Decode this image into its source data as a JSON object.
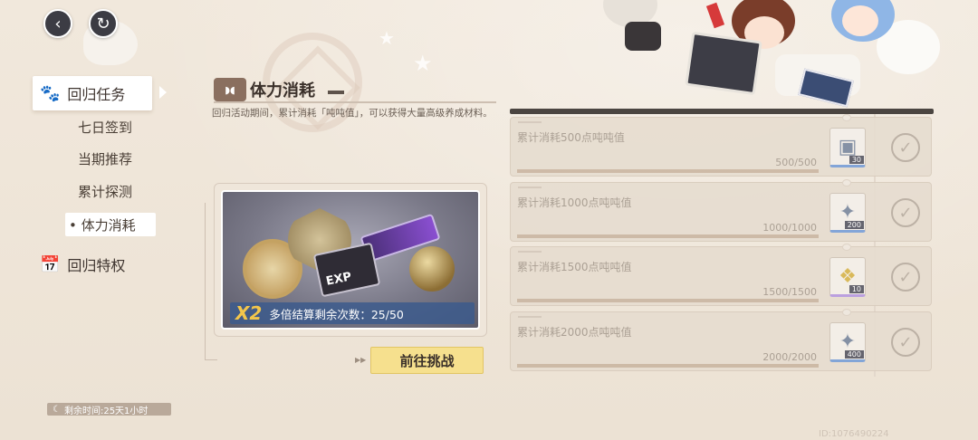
{
  "nav": {
    "back_icon": "back-arrow-icon",
    "refresh_icon": "refresh-icon"
  },
  "sidebar": {
    "main_items": [
      {
        "label": "回归任务",
        "icon": "paw-icon",
        "active": true
      },
      {
        "label": "回归特权",
        "icon": "calendar-icon",
        "active": false
      }
    ],
    "sub_items": [
      {
        "label": "七日签到",
        "active": false
      },
      {
        "label": "当期推荐",
        "active": false
      },
      {
        "label": "累计探测",
        "active": false
      },
      {
        "label": "• 体力消耗",
        "active": true
      }
    ],
    "remaining_time": "剩余时间:25天1小时"
  },
  "header": {
    "title": "体力消耗",
    "description": "回归活动期间，累计消耗「吨吨值」，可以获得大量高级养成材料。"
  },
  "banner": {
    "multiplier": "X2",
    "remaining_label": "多倍结算剩余次数：25/50",
    "exp_label": "EXP"
  },
  "go_button": {
    "label": "前往挑战"
  },
  "tasks": [
    {
      "label": "累计消耗500点吨吨值",
      "progress_text": "500/500",
      "progress": 1.0,
      "item_icon": "cube-icon",
      "item_qty": "30",
      "quality": "blue",
      "completed": true
    },
    {
      "label": "累计消耗1000点吨吨值",
      "progress_text": "1000/1000",
      "progress": 1.0,
      "item_icon": "star-crystal-icon",
      "item_qty": "200",
      "quality": "blue",
      "completed": true
    },
    {
      "label": "累计消耗1500点吨吨值",
      "progress_text": "1500/1500",
      "progress": 1.0,
      "item_icon": "gold-pile-icon",
      "item_qty": "10",
      "quality": "purple",
      "completed": true
    },
    {
      "label": "累计消耗2000点吨吨值",
      "progress_text": "2000/2000",
      "progress": 1.0,
      "item_icon": "star-crystal-icon",
      "item_qty": "400",
      "quality": "blue",
      "completed": true
    }
  ],
  "uid": "ID:1076490224"
}
